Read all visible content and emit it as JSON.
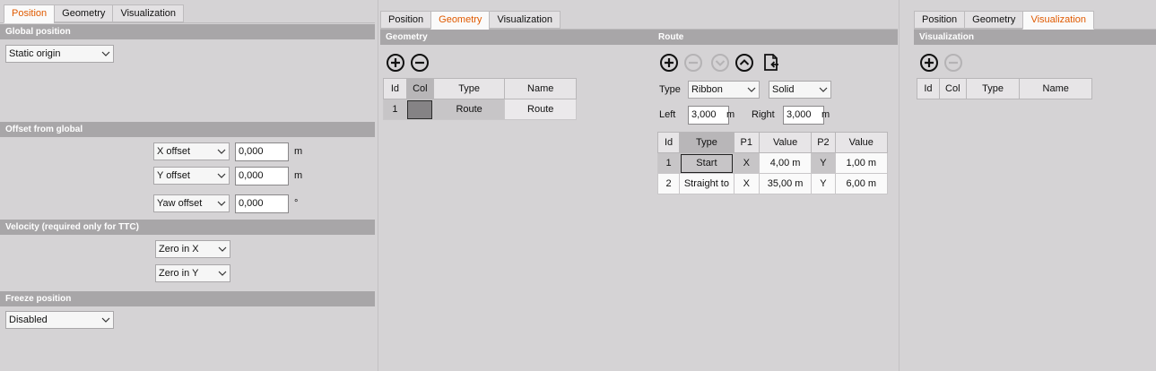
{
  "position_panel": {
    "tabs": [
      "Position",
      "Geometry",
      "Visualization"
    ],
    "active_tab": "Position",
    "global_position": {
      "header": "Global position",
      "select": "Static origin"
    },
    "offset": {
      "header": "Offset from global",
      "x_select": "X offset",
      "x_value": "0,000",
      "x_unit": "m",
      "y_select": "Y offset",
      "y_value": "0,000",
      "y_unit": "m",
      "yaw_select": "Yaw offset",
      "yaw_value": "0,000",
      "yaw_unit": "°"
    },
    "velocity": {
      "header": "Velocity (required only for TTC)",
      "x_select": "Zero in X",
      "y_select": "Zero in Y"
    },
    "freeze": {
      "header": "Freeze position",
      "select": "Disabled"
    }
  },
  "geometry_panel": {
    "tabs": [
      "Position",
      "Geometry",
      "Visualization"
    ],
    "active_tab": "Geometry",
    "geometry": {
      "header": "Geometry",
      "columns": [
        "Id",
        "Col",
        "Type",
        "Name"
      ],
      "rows": [
        {
          "id": "1",
          "type": "Route",
          "name": "Route",
          "color": "#858385"
        }
      ]
    },
    "route": {
      "header": "Route",
      "type_label": "Type",
      "type_select": "Ribbon",
      "style_select": "Solid",
      "left_label": "Left",
      "left_value": "3,000",
      "left_unit": "m",
      "right_label": "Right",
      "right_value": "3,000",
      "right_unit": "m",
      "columns": [
        "Id",
        "Type",
        "P1",
        "Value",
        "P2",
        "Value"
      ],
      "rows": [
        {
          "id": "1",
          "type": "Start",
          "p1": "X",
          "v1": "4,00 m",
          "p2": "Y",
          "v2": "1,00 m"
        },
        {
          "id": "2",
          "type": "Straight to",
          "p1": "X",
          "v1": "35,00 m",
          "p2": "Y",
          "v2": "6,00 m"
        }
      ]
    }
  },
  "visualization_panel": {
    "tabs": [
      "Position",
      "Geometry",
      "Visualization"
    ],
    "active_tab": "Visualization",
    "visualization": {
      "header": "Visualization",
      "columns": [
        "Id",
        "Col",
        "Type",
        "Name"
      ]
    }
  },
  "colors": {
    "accent": "#e05a00",
    "section_header": "#a8a6a8",
    "background": "#d5d3d5"
  }
}
